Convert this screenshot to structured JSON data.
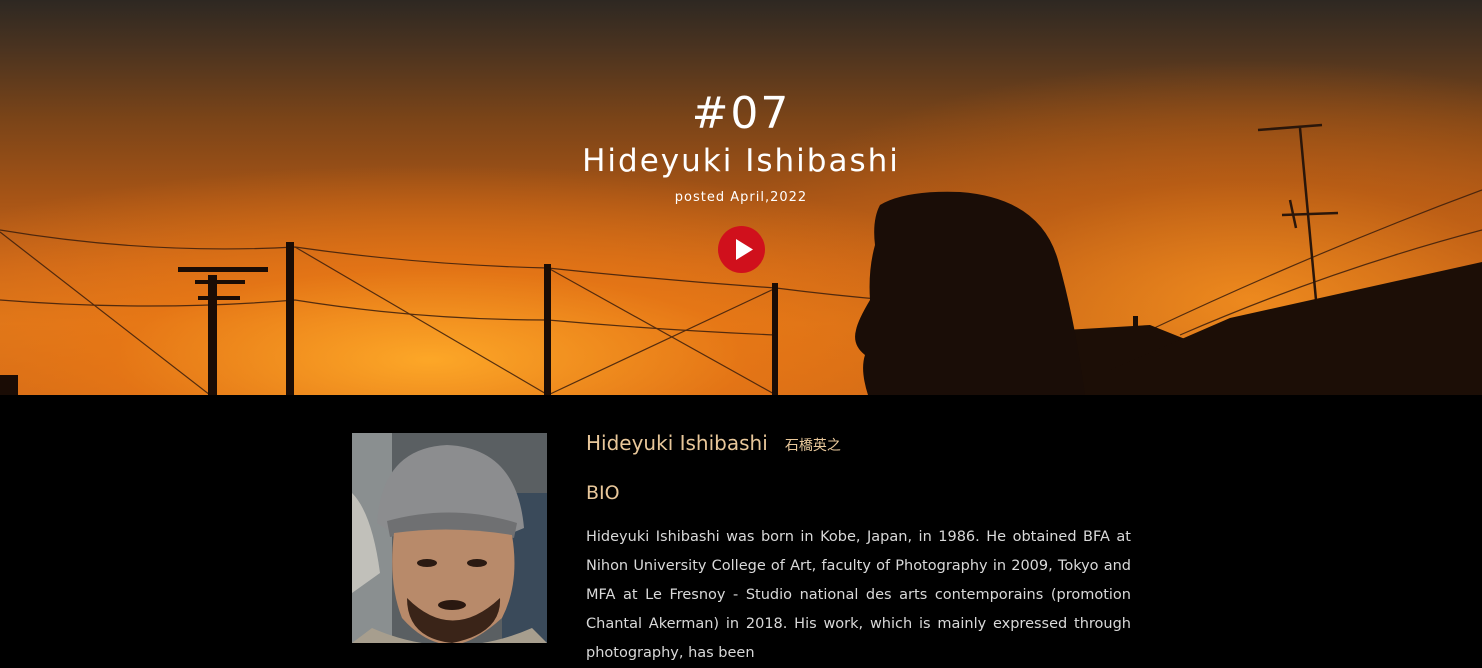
{
  "hero": {
    "episode": "#07",
    "name": "Hideyuki Ishibashi",
    "posted": "posted April,2022",
    "accent_color": "#d0101c"
  },
  "profile": {
    "name_en": "Hideyuki Ishibashi",
    "name_jp": "石橋英之",
    "bio_heading": "BIO",
    "bio_text": "Hideyuki Ishibashi was born in Kobe, Japan, in 1986. He obtained BFA at Nihon University College of Art, faculty of Photography in 2009, Tokyo and MFA at Le Fresnoy - Studio national des arts contemporains (promotion Chantal Akerman) in 2018. His work, which is mainly expressed through photography, has been",
    "heading_color": "#e8c79a"
  }
}
